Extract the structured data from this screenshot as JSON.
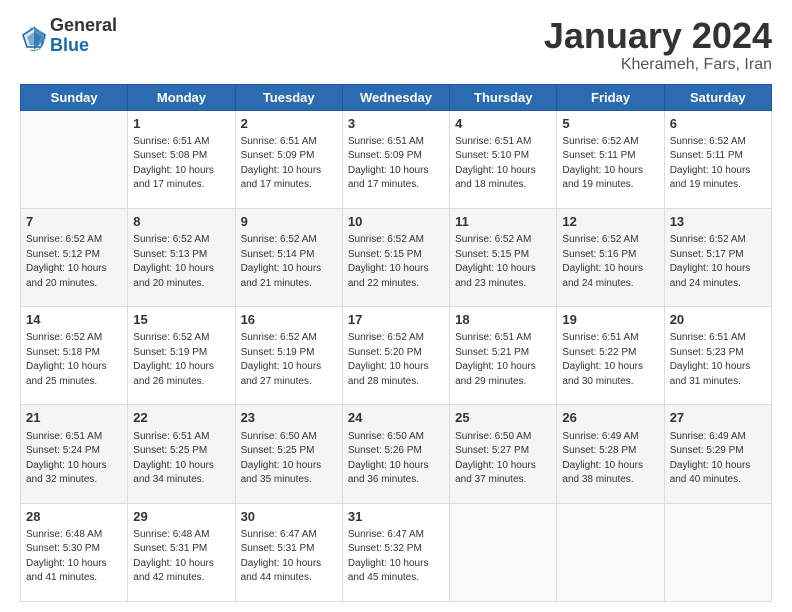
{
  "header": {
    "logo_general": "General",
    "logo_blue": "Blue",
    "month": "January 2024",
    "location": "Kherameh, Fars, Iran"
  },
  "days_of_week": [
    "Sunday",
    "Monday",
    "Tuesday",
    "Wednesday",
    "Thursday",
    "Friday",
    "Saturday"
  ],
  "weeks": [
    [
      {
        "num": "",
        "info": ""
      },
      {
        "num": "1",
        "info": "Sunrise: 6:51 AM\nSunset: 5:08 PM\nDaylight: 10 hours\nand 17 minutes."
      },
      {
        "num": "2",
        "info": "Sunrise: 6:51 AM\nSunset: 5:09 PM\nDaylight: 10 hours\nand 17 minutes."
      },
      {
        "num": "3",
        "info": "Sunrise: 6:51 AM\nSunset: 5:09 PM\nDaylight: 10 hours\nand 17 minutes."
      },
      {
        "num": "4",
        "info": "Sunrise: 6:51 AM\nSunset: 5:10 PM\nDaylight: 10 hours\nand 18 minutes."
      },
      {
        "num": "5",
        "info": "Sunrise: 6:52 AM\nSunset: 5:11 PM\nDaylight: 10 hours\nand 19 minutes."
      },
      {
        "num": "6",
        "info": "Sunrise: 6:52 AM\nSunset: 5:11 PM\nDaylight: 10 hours\nand 19 minutes."
      }
    ],
    [
      {
        "num": "7",
        "info": "Sunrise: 6:52 AM\nSunset: 5:12 PM\nDaylight: 10 hours\nand 20 minutes."
      },
      {
        "num": "8",
        "info": "Sunrise: 6:52 AM\nSunset: 5:13 PM\nDaylight: 10 hours\nand 20 minutes."
      },
      {
        "num": "9",
        "info": "Sunrise: 6:52 AM\nSunset: 5:14 PM\nDaylight: 10 hours\nand 21 minutes."
      },
      {
        "num": "10",
        "info": "Sunrise: 6:52 AM\nSunset: 5:15 PM\nDaylight: 10 hours\nand 22 minutes."
      },
      {
        "num": "11",
        "info": "Sunrise: 6:52 AM\nSunset: 5:15 PM\nDaylight: 10 hours\nand 23 minutes."
      },
      {
        "num": "12",
        "info": "Sunrise: 6:52 AM\nSunset: 5:16 PM\nDaylight: 10 hours\nand 24 minutes."
      },
      {
        "num": "13",
        "info": "Sunrise: 6:52 AM\nSunset: 5:17 PM\nDaylight: 10 hours\nand 24 minutes."
      }
    ],
    [
      {
        "num": "14",
        "info": "Sunrise: 6:52 AM\nSunset: 5:18 PM\nDaylight: 10 hours\nand 25 minutes."
      },
      {
        "num": "15",
        "info": "Sunrise: 6:52 AM\nSunset: 5:19 PM\nDaylight: 10 hours\nand 26 minutes."
      },
      {
        "num": "16",
        "info": "Sunrise: 6:52 AM\nSunset: 5:19 PM\nDaylight: 10 hours\nand 27 minutes."
      },
      {
        "num": "17",
        "info": "Sunrise: 6:52 AM\nSunset: 5:20 PM\nDaylight: 10 hours\nand 28 minutes."
      },
      {
        "num": "18",
        "info": "Sunrise: 6:51 AM\nSunset: 5:21 PM\nDaylight: 10 hours\nand 29 minutes."
      },
      {
        "num": "19",
        "info": "Sunrise: 6:51 AM\nSunset: 5:22 PM\nDaylight: 10 hours\nand 30 minutes."
      },
      {
        "num": "20",
        "info": "Sunrise: 6:51 AM\nSunset: 5:23 PM\nDaylight: 10 hours\nand 31 minutes."
      }
    ],
    [
      {
        "num": "21",
        "info": "Sunrise: 6:51 AM\nSunset: 5:24 PM\nDaylight: 10 hours\nand 32 minutes."
      },
      {
        "num": "22",
        "info": "Sunrise: 6:51 AM\nSunset: 5:25 PM\nDaylight: 10 hours\nand 34 minutes."
      },
      {
        "num": "23",
        "info": "Sunrise: 6:50 AM\nSunset: 5:25 PM\nDaylight: 10 hours\nand 35 minutes."
      },
      {
        "num": "24",
        "info": "Sunrise: 6:50 AM\nSunset: 5:26 PM\nDaylight: 10 hours\nand 36 minutes."
      },
      {
        "num": "25",
        "info": "Sunrise: 6:50 AM\nSunset: 5:27 PM\nDaylight: 10 hours\nand 37 minutes."
      },
      {
        "num": "26",
        "info": "Sunrise: 6:49 AM\nSunset: 5:28 PM\nDaylight: 10 hours\nand 38 minutes."
      },
      {
        "num": "27",
        "info": "Sunrise: 6:49 AM\nSunset: 5:29 PM\nDaylight: 10 hours\nand 40 minutes."
      }
    ],
    [
      {
        "num": "28",
        "info": "Sunrise: 6:48 AM\nSunset: 5:30 PM\nDaylight: 10 hours\nand 41 minutes."
      },
      {
        "num": "29",
        "info": "Sunrise: 6:48 AM\nSunset: 5:31 PM\nDaylight: 10 hours\nand 42 minutes."
      },
      {
        "num": "30",
        "info": "Sunrise: 6:47 AM\nSunset: 5:31 PM\nDaylight: 10 hours\nand 44 minutes."
      },
      {
        "num": "31",
        "info": "Sunrise: 6:47 AM\nSunset: 5:32 PM\nDaylight: 10 hours\nand 45 minutes."
      },
      {
        "num": "",
        "info": ""
      },
      {
        "num": "",
        "info": ""
      },
      {
        "num": "",
        "info": ""
      }
    ]
  ]
}
